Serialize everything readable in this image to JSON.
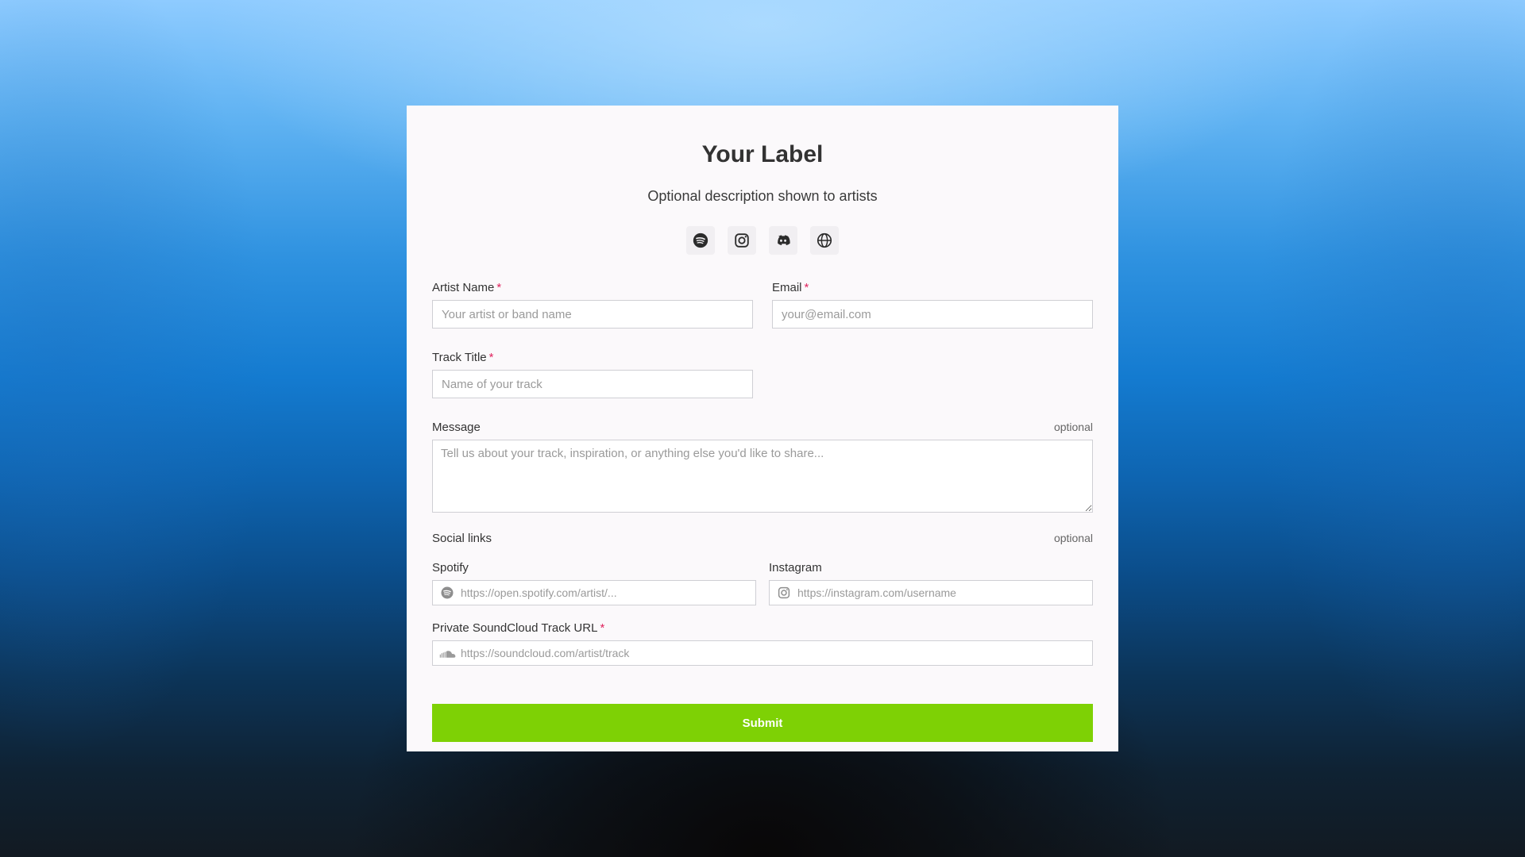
{
  "header": {
    "title": "Your Label",
    "description": "Optional description shown to artists"
  },
  "social_icons": [
    {
      "name": "spotify-icon"
    },
    {
      "name": "instagram-icon"
    },
    {
      "name": "discord-icon"
    },
    {
      "name": "globe-icon"
    }
  ],
  "form": {
    "artist_name": {
      "label": "Artist Name",
      "required_mark": "*",
      "placeholder": "Your artist or band name",
      "value": ""
    },
    "email": {
      "label": "Email",
      "required_mark": "*",
      "placeholder": "your@email.com",
      "value": ""
    },
    "track_title": {
      "label": "Track Title",
      "required_mark": "*",
      "placeholder": "Name of your track",
      "value": ""
    },
    "message": {
      "label": "Message",
      "optional_label": "optional",
      "placeholder": "Tell us about your track, inspiration, or anything else you'd like to share...",
      "value": ""
    },
    "social_links": {
      "label": "Social links",
      "optional_label": "optional",
      "spotify": {
        "label": "Spotify",
        "placeholder": "https://open.spotify.com/artist/...",
        "value": ""
      },
      "instagram": {
        "label": "Instagram",
        "placeholder": "https://instagram.com/username",
        "value": ""
      }
    },
    "soundcloud": {
      "label": "Private SoundCloud Track URL",
      "required_mark": "*",
      "placeholder": "https://soundcloud.com/artist/track",
      "value": ""
    },
    "submit_label": "Submit"
  },
  "colors": {
    "accent": "#7ed105",
    "required": "#e0245e",
    "card_bg": "#fbf9fb"
  }
}
